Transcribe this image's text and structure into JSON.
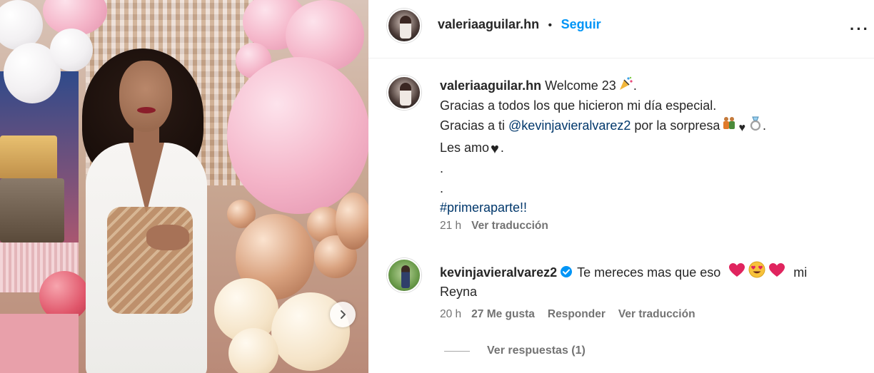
{
  "post": {
    "author": "valeriaaguilar.hn",
    "follow_label": "Seguir",
    "more_label": "···",
    "separator": "•"
  },
  "caption": {
    "author": "valeriaaguilar.hn",
    "line1_text": "Welcome 23",
    "line2": "Gracias a todos los que hicieron mi día especial.",
    "line3_pre": "Gracias a ti ",
    "line3_mention": "@kevinjavieralvarez2",
    "line3_post": " por la sorpresa",
    "line4": "Les amo",
    "dot1": ".",
    "dot2": ".",
    "hashtag": "#primeraparte!!",
    "time": "21 h",
    "translate_label": "Ver traducción"
  },
  "comment": {
    "author": "kevinjavieralvarez2",
    "text_pre": "Te mereces mas que eso",
    "text_mid": "mi",
    "text_line2": "Reyna",
    "time": "20 h",
    "likes": "27 Me gusta",
    "reply_label": "Responder",
    "translate_label": "Ver traducción",
    "view_replies": "Ver respuestas (1)"
  },
  "colors": {
    "follow": "#0095f6",
    "mention": "#00376b",
    "muted": "#737373",
    "verified": "#0095f6",
    "heart_red": "#e0245e"
  },
  "icons": {
    "next": "chevron-right-icon",
    "more": "more-horizontal-icon",
    "verified": "verified-badge-icon"
  }
}
